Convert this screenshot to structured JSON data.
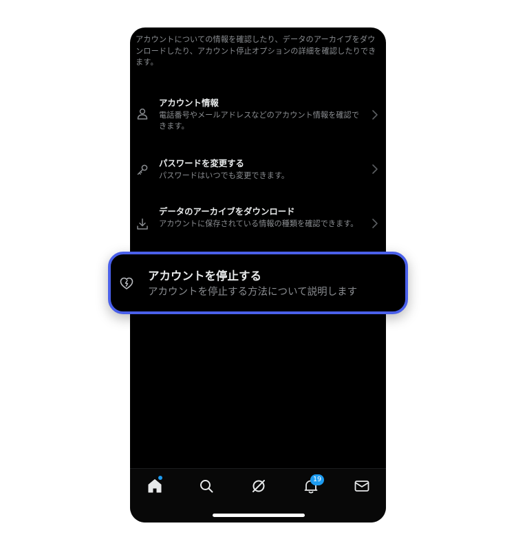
{
  "intro_text": "アカウントについての情報を確認したり、データのアーカイブをダウンロードしたり、アカウント停止オプションの詳細を確認したりできます。",
  "menu": {
    "items": [
      {
        "icon": "person-icon",
        "title": "アカウント情報",
        "description": "電話番号やメールアドレスなどのアカウント情報を確認できます。"
      },
      {
        "icon": "key-icon",
        "title": "パスワードを変更する",
        "description": "パスワードはいつでも変更できます。"
      },
      {
        "icon": "download-icon",
        "title": "データのアーカイブをダウンロード",
        "description": "アカウントに保存されている情報の種類を確認できます。"
      }
    ]
  },
  "highlighted_item": {
    "icon": "broken-heart-icon",
    "title": "アカウントを停止する",
    "description": "アカウントを停止する方法について説明します"
  },
  "tab_bar": {
    "tabs": [
      "home-icon",
      "search-icon",
      "grok-icon",
      "bell-icon",
      "mail-icon"
    ],
    "notification_badge": "19"
  },
  "colors": {
    "background": "#000000",
    "primary_text": "#e7e9ea",
    "secondary_text": "#8a8d91",
    "accent": "#1d9bf0",
    "highlight_border": "#4a60ea"
  }
}
